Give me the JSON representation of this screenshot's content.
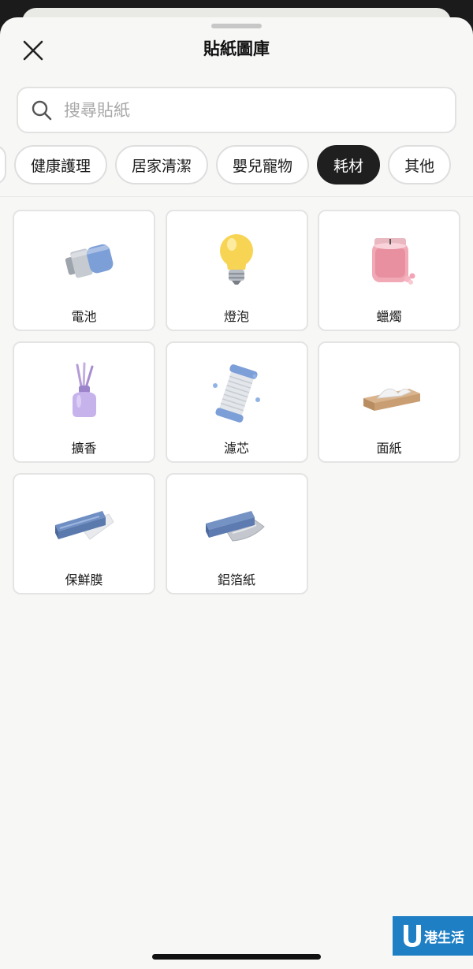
{
  "header": {
    "title": "貼紙圖庫"
  },
  "search": {
    "placeholder": "搜尋貼紙"
  },
  "categories": [
    {
      "label": ""
    },
    {
      "label": "健康護理"
    },
    {
      "label": "居家清潔"
    },
    {
      "label": "嬰兒寵物"
    },
    {
      "label": "耗材",
      "selected": true
    },
    {
      "label": "其他"
    }
  ],
  "stickers": [
    {
      "label": "電池",
      "icon": "battery-icon"
    },
    {
      "label": "燈泡",
      "icon": "light-bulb-icon"
    },
    {
      "label": "蠟燭",
      "icon": "candle-jar-icon"
    },
    {
      "label": "擴香",
      "icon": "reed-diffuser-icon"
    },
    {
      "label": "濾芯",
      "icon": "water-filter-icon"
    },
    {
      "label": "面紙",
      "icon": "tissue-box-icon"
    },
    {
      "label": "保鮮膜",
      "icon": "cling-wrap-icon"
    },
    {
      "label": "鋁箔紙",
      "icon": "foil-roll-icon"
    }
  ],
  "watermark": {
    "logo": "港生活",
    "icon": "u-lifestyle-logo-icon"
  },
  "colors": {
    "selected_chip": "#1f1f1f",
    "background": "#f7f7f5",
    "card_border": "#e4e4e4"
  }
}
